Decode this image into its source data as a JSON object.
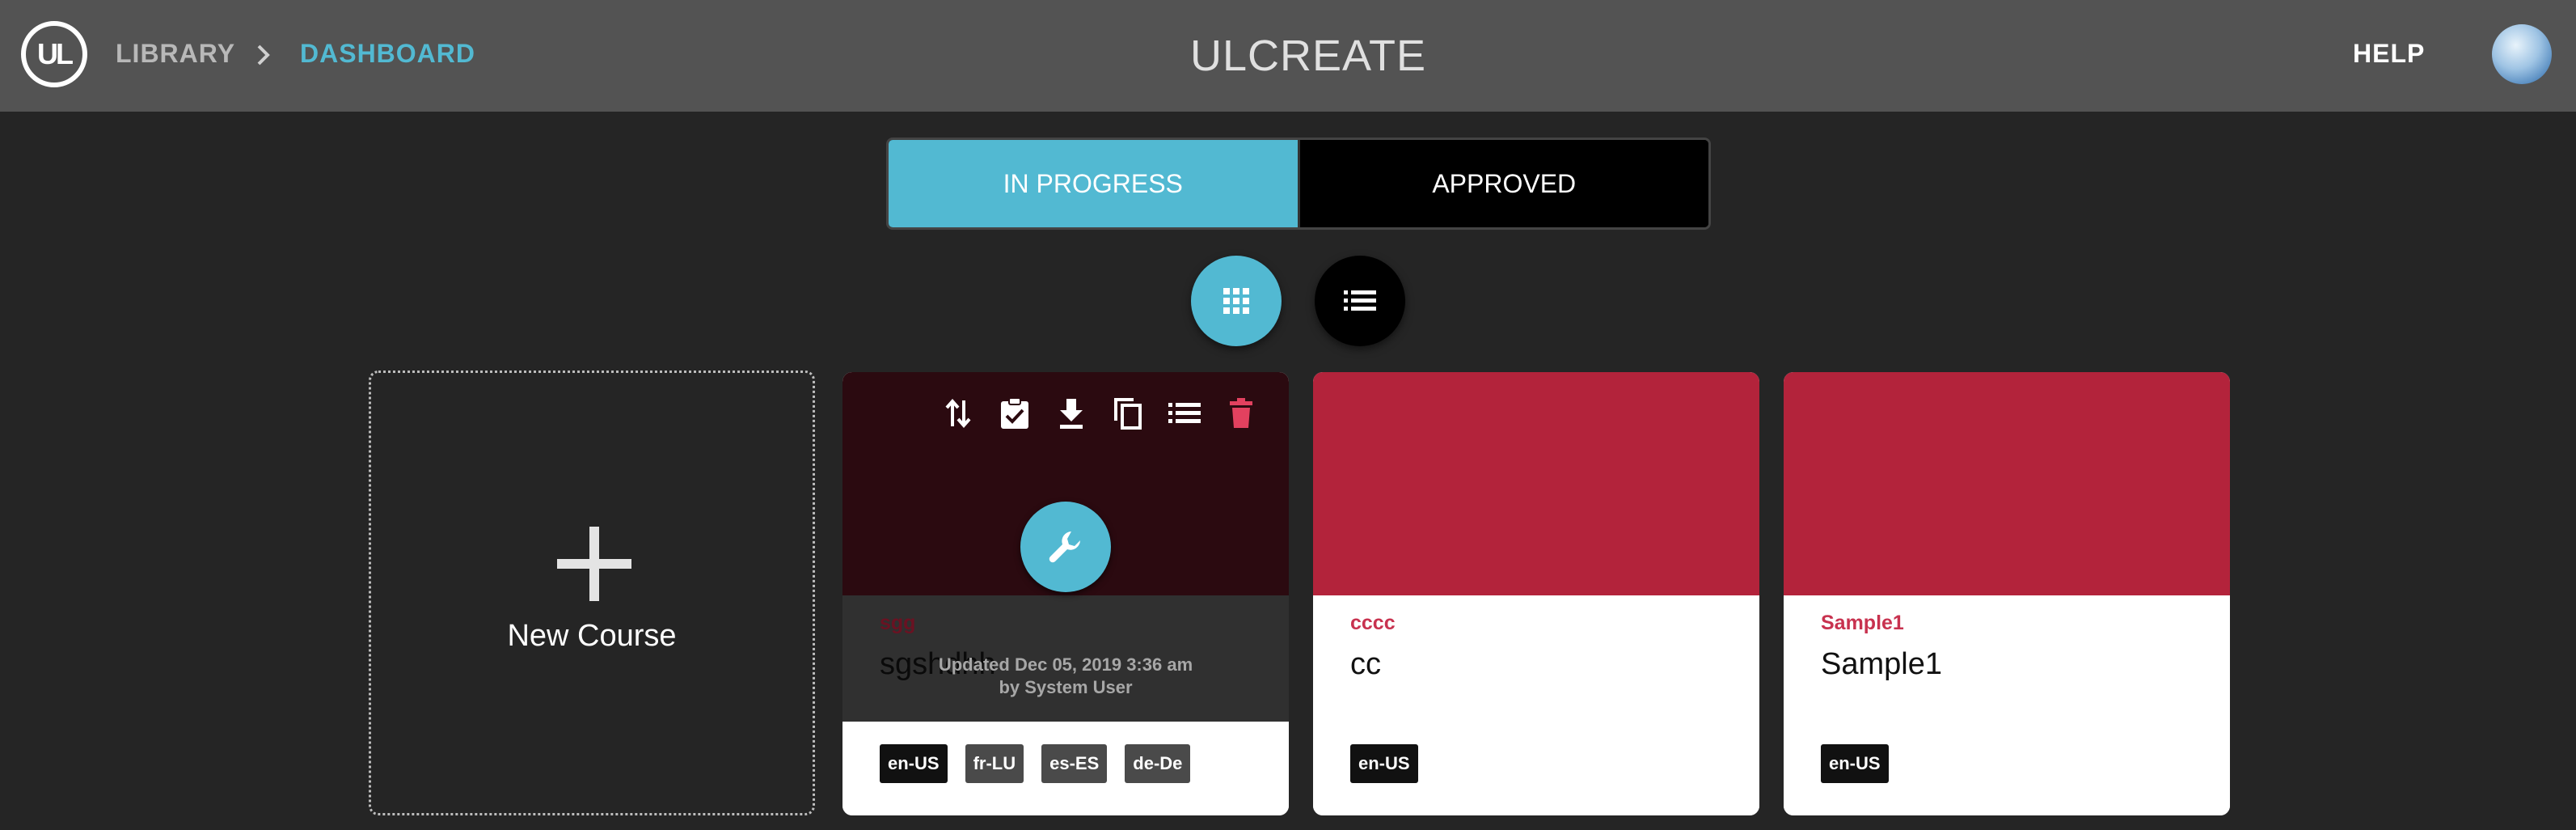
{
  "header": {
    "logo_text": "UL",
    "breadcrumb": [
      {
        "label": "LIBRARY"
      },
      {
        "label": "DASHBOARD"
      }
    ],
    "app_title": "ULCREATE",
    "help_label": "HELP",
    "avatar_icon": "user-avatar"
  },
  "tabs": [
    {
      "label": "IN PROGRESS",
      "active": true
    },
    {
      "label": "APPROVED",
      "active": false
    }
  ],
  "view_toggle": {
    "grid_icon": "grid-icon",
    "list_icon": "list-icon",
    "selected": "grid"
  },
  "new_course": {
    "label": "New Course",
    "icon": "plus-icon"
  },
  "cards": [
    {
      "code": "sgg",
      "name": "sgshdhh",
      "updated_line1": "Updated Dec 05, 2019 3:36 am",
      "updated_line2": "by System User",
      "languages": [
        "en-US",
        "fr-LU",
        "es-ES",
        "de-De"
      ],
      "actions": [
        "sort-icon",
        "clipboard-check-icon",
        "download-icon",
        "copy-icon",
        "list-icon",
        "trash-icon"
      ],
      "edit_icon": "wrench-icon"
    },
    {
      "code": "cccc",
      "name": "cc",
      "languages": [
        "en-US"
      ]
    },
    {
      "code": "Sample1",
      "name": "Sample1",
      "languages": [
        "en-US"
      ]
    }
  ],
  "colors": {
    "accent": "#52b9d2",
    "card_header": "#b3233b",
    "code_text": "#c8324f",
    "delete": "#e2415f",
    "header_bg": "#535353",
    "page_bg": "#252525"
  }
}
